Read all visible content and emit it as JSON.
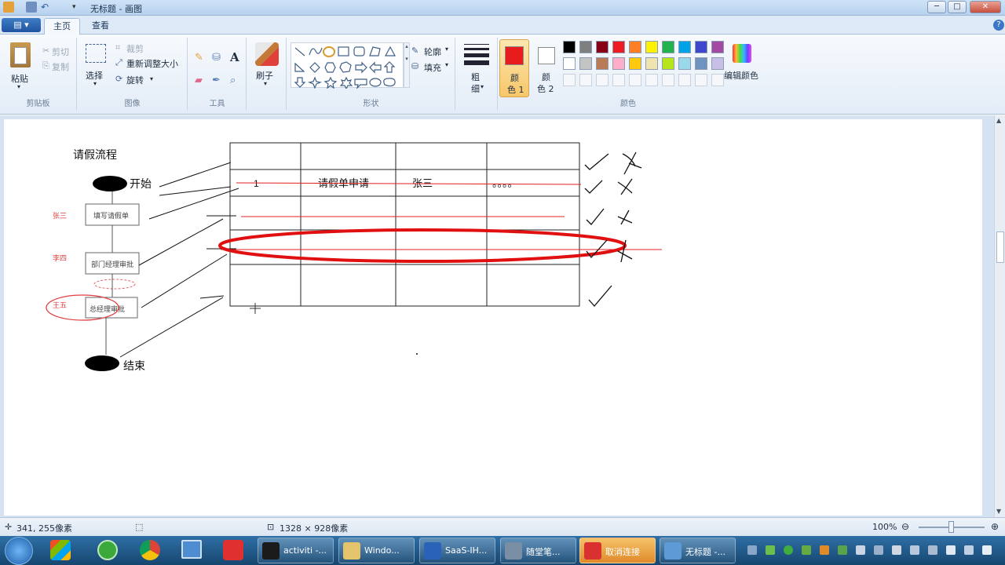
{
  "window": {
    "title": "无标题 - 画图",
    "buttons": {
      "minimize": "─",
      "maximize": "□",
      "close": "✕"
    }
  },
  "tabs": {
    "file": "▤ ▾",
    "home": "主页",
    "view": "查看",
    "help": "?"
  },
  "ribbon": {
    "clipboard": {
      "paste": "粘贴",
      "cut": "剪切",
      "copy": "复制",
      "label": "剪贴板"
    },
    "image": {
      "select": "选择",
      "crop": "裁剪",
      "resize": "重新调整大小",
      "rotate": "旋转",
      "label": "图像"
    },
    "tools": {
      "label": "工具"
    },
    "brushes": {
      "label": "刷子"
    },
    "shapes": {
      "outline": "轮廓",
      "fill": "填充",
      "label": "形状"
    },
    "size": {
      "label1": "粗",
      "label2": "细"
    },
    "colors": {
      "color1_label1": "颜",
      "color1_label2": "色 1",
      "color2_label1": "颜",
      "color2_label2": "色 2",
      "edit": "编辑颜色",
      "label": "颜色",
      "color1": "#e81c1c",
      "color2": "#ffffff",
      "palette_row1": [
        "#000000",
        "#7f7f7f",
        "#880015",
        "#ed1c24",
        "#ff7f27",
        "#fff200",
        "#22b14c",
        "#00a2e8",
        "#3f48cc",
        "#a349a4"
      ],
      "palette_row2": [
        "#ffffff",
        "#c3c3c3",
        "#b97a57",
        "#ffaec9",
        "#ffc90e",
        "#efe4b0",
        "#b5e61d",
        "#99d9ea",
        "#7092be",
        "#c8bfe7"
      ]
    }
  },
  "drawing": {
    "title": "请假流程",
    "start": "开始",
    "end": "结束",
    "node1": "填写请假单",
    "node2": "部门经理审批",
    "node3": "总经理审批",
    "assignee1": "张三",
    "assignee2": "李四",
    "assignee3": "王五",
    "row_id": "1",
    "row_name": "请假单申请",
    "row_person": "张三",
    "row_more": "。。。。"
  },
  "statusbar": {
    "cursor_pos": "341, 255像素",
    "canvas_size": "1328 × 928像素",
    "zoom": "100%"
  },
  "taskbar": [
    {
      "label": "activiti -...",
      "color": "#1b1b1b"
    },
    {
      "label": "Windo...",
      "color": "#e4c46a"
    },
    {
      "label": "SaaS-IH...",
      "color": "#2a62b8"
    },
    {
      "label": "随堂笔...",
      "color": "#7a8ea6"
    },
    {
      "label": "取消连接",
      "color": "#d93030"
    },
    {
      "label": "无标题 -...",
      "color": "#5e9ad6"
    }
  ]
}
